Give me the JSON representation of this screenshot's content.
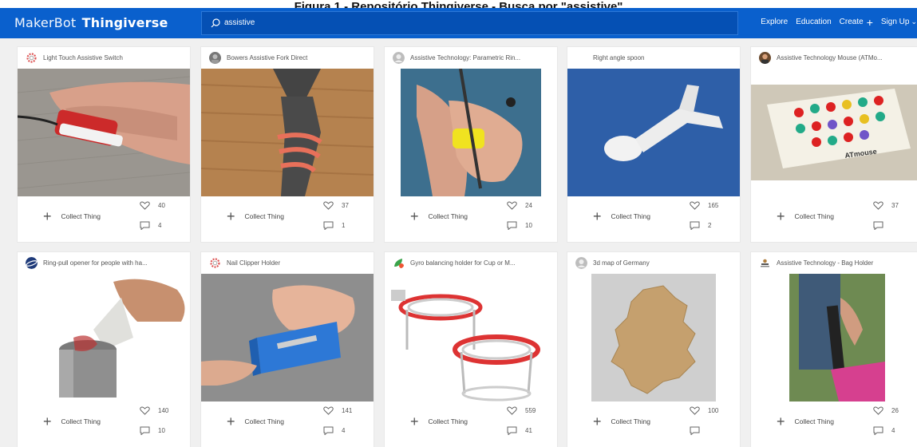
{
  "caption": "Figura 1 - Repositório Thingiverse - Busca por \"assistive\"",
  "header": {
    "brand": "MakerBot",
    "product": "Thingiverse",
    "search_value": "assistive",
    "nav": [
      "Explore",
      "Education",
      "Create",
      "Sign Up"
    ]
  },
  "colors": {
    "topbar": "#0a60cd",
    "accent": "#0a60cd",
    "background": "#f0f0f0"
  },
  "collect_label": "Collect Thing",
  "cards": [
    {
      "title": "Light Touch Assistive Switch",
      "likes": "40",
      "comments": "4",
      "avatar": "gear-avatar-icon"
    },
    {
      "title": "Bowers Assistive Fork Direct",
      "likes": "37",
      "comments": "1",
      "avatar": "user-photo-avatar"
    },
    {
      "title": "Assistive Technology: Parametric Rin...",
      "likes": "24",
      "comments": "10",
      "avatar": "default-user-avatar"
    },
    {
      "title": "Right angle spoon",
      "likes": "165",
      "comments": "2",
      "avatar": "none"
    },
    {
      "title": "Assistive Technology Mouse (ATMo...",
      "likes": "37",
      "comments": "",
      "avatar": "user-photo-avatar"
    },
    {
      "title": "Ring-pull opener for people with ha...",
      "likes": "140",
      "comments": "10",
      "avatar": "planet-avatar"
    },
    {
      "title": "Nail Clipper Holder",
      "likes": "141",
      "comments": "4",
      "avatar": "gear-avatar-icon"
    },
    {
      "title": "Gyro balancing holder for Cup or M...",
      "likes": "559",
      "comments": "41",
      "avatar": "leaf-avatar"
    },
    {
      "title": "3d map of Germany",
      "likes": "100",
      "comments": "",
      "avatar": "default-user-avatar"
    },
    {
      "title": "Assistive Technology - Bag Holder",
      "likes": "26",
      "comments": "4",
      "avatar": "user-photo-avatar"
    }
  ]
}
